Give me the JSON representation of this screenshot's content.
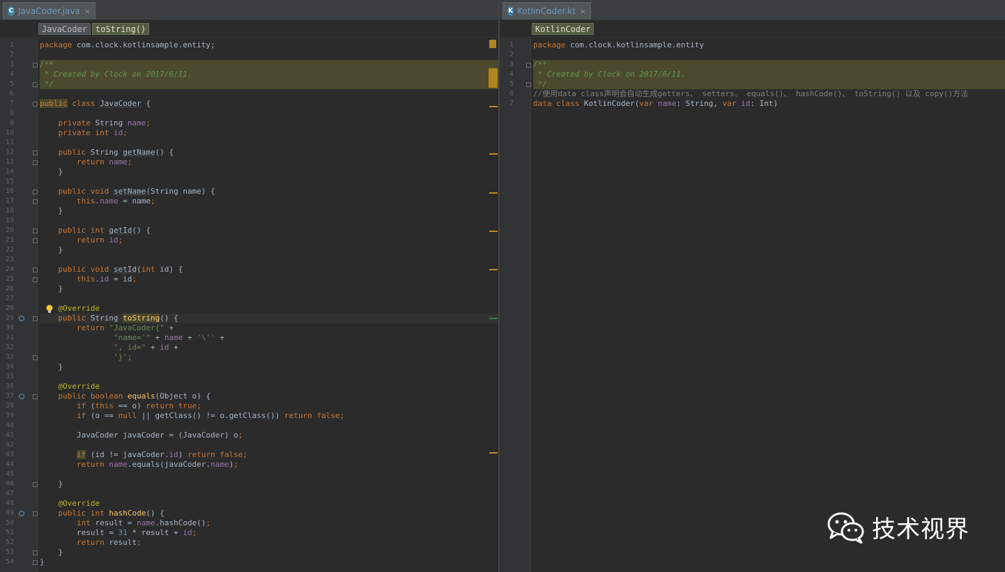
{
  "left_editor": {
    "tab": {
      "file_icon_letter": "C",
      "label": "JavaCoder.java",
      "close": "×"
    },
    "breadcrumbs": [
      "JavaCoder",
      "toString()"
    ]
  },
  "right_editor": {
    "tab": {
      "file_icon_letter": "K",
      "label": "KotlinCoder.kt",
      "close": "×"
    },
    "breadcrumbs": [
      "KotlinCoder"
    ]
  },
  "java_code": [
    [
      [
        "k",
        "package"
      ],
      [
        "t",
        " com.clock.kotlinsample.entity;"
      ]
    ],
    [],
    [
      [
        "c",
        "/**"
      ]
    ],
    [
      [
        "c",
        " * Created by Clock on 2017/6/11."
      ]
    ],
    [
      [
        "c",
        " */"
      ]
    ],
    [],
    [
      [
        "kw",
        "public"
      ],
      [
        "k",
        " class "
      ],
      [
        "u",
        "JavaCoder"
      ],
      [
        "t",
        " {"
      ]
    ],
    [],
    [
      [
        "t",
        "    "
      ],
      [
        "k",
        "private "
      ],
      [
        "t",
        "String "
      ],
      [
        "f",
        "name"
      ],
      [
        "k",
        ";"
      ]
    ],
    [
      [
        "t",
        "    "
      ],
      [
        "k",
        "private int "
      ],
      [
        "f",
        "id"
      ],
      [
        "k",
        ";"
      ]
    ],
    [],
    [
      [
        "t",
        "    "
      ],
      [
        "k",
        "public "
      ],
      [
        "t",
        "String "
      ],
      [
        "u",
        "getName"
      ],
      [
        "t",
        "() {"
      ]
    ],
    [
      [
        "t",
        "        "
      ],
      [
        "k",
        "return "
      ],
      [
        "f",
        "name"
      ],
      [
        "k",
        ";"
      ]
    ],
    [
      [
        "t",
        "    }"
      ]
    ],
    [],
    [
      [
        "t",
        "    "
      ],
      [
        "k",
        "public void "
      ],
      [
        "u",
        "setName"
      ],
      [
        "t",
        "(String name) {"
      ]
    ],
    [
      [
        "t",
        "        "
      ],
      [
        "k",
        "this"
      ],
      [
        "t",
        "."
      ],
      [
        "f",
        "name"
      ],
      [
        "t",
        " = name"
      ],
      [
        "k",
        ";"
      ]
    ],
    [
      [
        "t",
        "    }"
      ]
    ],
    [],
    [
      [
        "t",
        "    "
      ],
      [
        "k",
        "public int "
      ],
      [
        "u",
        "getId"
      ],
      [
        "t",
        "() {"
      ]
    ],
    [
      [
        "t",
        "        "
      ],
      [
        "k",
        "return "
      ],
      [
        "f",
        "id"
      ],
      [
        "k",
        ";"
      ]
    ],
    [
      [
        "t",
        "    }"
      ]
    ],
    [],
    [
      [
        "t",
        "    "
      ],
      [
        "k",
        "public void "
      ],
      [
        "u",
        "setId"
      ],
      [
        "t",
        "("
      ],
      [
        "k",
        "int "
      ],
      [
        "t",
        "id) {"
      ]
    ],
    [
      [
        "t",
        "        "
      ],
      [
        "k",
        "this"
      ],
      [
        "t",
        "."
      ],
      [
        "f",
        "id"
      ],
      [
        "t",
        " = id"
      ],
      [
        "k",
        ";"
      ]
    ],
    [
      [
        "t",
        "    }"
      ]
    ],
    [],
    [
      [
        "t",
        "    "
      ],
      [
        "an",
        "@Override"
      ]
    ],
    [
      [
        "t",
        "    "
      ],
      [
        "k",
        "public "
      ],
      [
        "t",
        "String "
      ],
      [
        "mw",
        "toString"
      ],
      [
        "t",
        "() {"
      ]
    ],
    [
      [
        "t",
        "        "
      ],
      [
        "k",
        "return "
      ],
      [
        "s",
        "\"JavaCoder{\""
      ],
      [
        "t",
        " +"
      ]
    ],
    [
      [
        "t",
        "                "
      ],
      [
        "s",
        "\"name='\""
      ],
      [
        "t",
        " + "
      ],
      [
        "f",
        "name"
      ],
      [
        "t",
        " + "
      ],
      [
        "s",
        "'\\''"
      ],
      [
        "t",
        " +"
      ]
    ],
    [
      [
        "t",
        "                "
      ],
      [
        "s",
        "\", id=\""
      ],
      [
        "t",
        " + "
      ],
      [
        "f",
        "id"
      ],
      [
        "t",
        " +"
      ]
    ],
    [
      [
        "t",
        "                "
      ],
      [
        "s",
        "'}'"
      ],
      [
        "k",
        ";"
      ]
    ],
    [
      [
        "t",
        "    }"
      ]
    ],
    [],
    [
      [
        "t",
        "    "
      ],
      [
        "an",
        "@Override"
      ]
    ],
    [
      [
        "t",
        "    "
      ],
      [
        "k",
        "public boolean "
      ],
      [
        "m",
        "equals"
      ],
      [
        "t",
        "(Object o) {"
      ]
    ],
    [
      [
        "t",
        "        "
      ],
      [
        "k",
        "if "
      ],
      [
        "t",
        "("
      ],
      [
        "k",
        "this "
      ],
      [
        "t",
        "== o) "
      ],
      [
        "k",
        "return true;"
      ]
    ],
    [
      [
        "t",
        "        "
      ],
      [
        "k",
        "if "
      ],
      [
        "t",
        "(o == "
      ],
      [
        "k",
        "null "
      ],
      [
        "t",
        "|| getClass() != o.getClass()) "
      ],
      [
        "k",
        "return false;"
      ]
    ],
    [],
    [
      [
        "t",
        "        JavaCoder javaCoder = (JavaCoder) o"
      ],
      [
        "k",
        ";"
      ]
    ],
    [],
    [
      [
        "t",
        "        "
      ],
      [
        "kw",
        "if"
      ],
      [
        "t",
        " (id != javaCoder."
      ],
      [
        "f",
        "id"
      ],
      [
        "t",
        ") "
      ],
      [
        "k",
        "return false;"
      ]
    ],
    [
      [
        "t",
        "        "
      ],
      [
        "k",
        "return "
      ],
      [
        "f",
        "name"
      ],
      [
        "t",
        ".equals(javaCoder."
      ],
      [
        "f",
        "name"
      ],
      [
        "t",
        ")"
      ],
      [
        "k",
        ";"
      ]
    ],
    [],
    [
      [
        "t",
        "    }"
      ]
    ],
    [],
    [
      [
        "t",
        "    "
      ],
      [
        "an",
        "@Override"
      ]
    ],
    [
      [
        "t",
        "    "
      ],
      [
        "k",
        "public int "
      ],
      [
        "m",
        "hashCode"
      ],
      [
        "t",
        "() {"
      ]
    ],
    [
      [
        "t",
        "        "
      ],
      [
        "k",
        "int "
      ],
      [
        "t",
        "result = "
      ],
      [
        "f",
        "name"
      ],
      [
        "t",
        ".hashCode()"
      ],
      [
        "k",
        ";"
      ]
    ],
    [
      [
        "t",
        "        result = "
      ],
      [
        "n",
        "31"
      ],
      [
        "t",
        " * result + "
      ],
      [
        "f",
        "id"
      ],
      [
        "k",
        ";"
      ]
    ],
    [
      [
        "t",
        "        "
      ],
      [
        "k",
        "return "
      ],
      [
        "t",
        "result"
      ],
      [
        "k",
        ";"
      ]
    ],
    [
      [
        "t",
        "    }"
      ]
    ],
    [
      [
        "t",
        "}"
      ]
    ]
  ],
  "kotlin_code": [
    [
      [
        "k",
        "package"
      ],
      [
        "t",
        " com.clock.kotlinsample.entity"
      ]
    ],
    [],
    [
      [
        "c",
        "/**"
      ]
    ],
    [
      [
        "c",
        " * Created by Clock on 2017/6/11."
      ]
    ],
    [
      [
        "c",
        " */"
      ]
    ],
    [
      [
        "lc",
        "//使用data class声明会自动生成getters、 setters、 equals()、 hashCode()、 toString() 以及 copy()方法"
      ]
    ],
    [
      [
        "k",
        "data class "
      ],
      [
        "t",
        "KotlinCoder("
      ],
      [
        "k",
        "var "
      ],
      [
        "f",
        "name"
      ],
      [
        "t",
        ": String, "
      ],
      [
        "k",
        "var "
      ],
      [
        "f",
        "id"
      ],
      [
        "t",
        ": Int)"
      ]
    ]
  ],
  "watermark": {
    "text": "技术视界",
    "icon": "wechat-logo-icon"
  }
}
